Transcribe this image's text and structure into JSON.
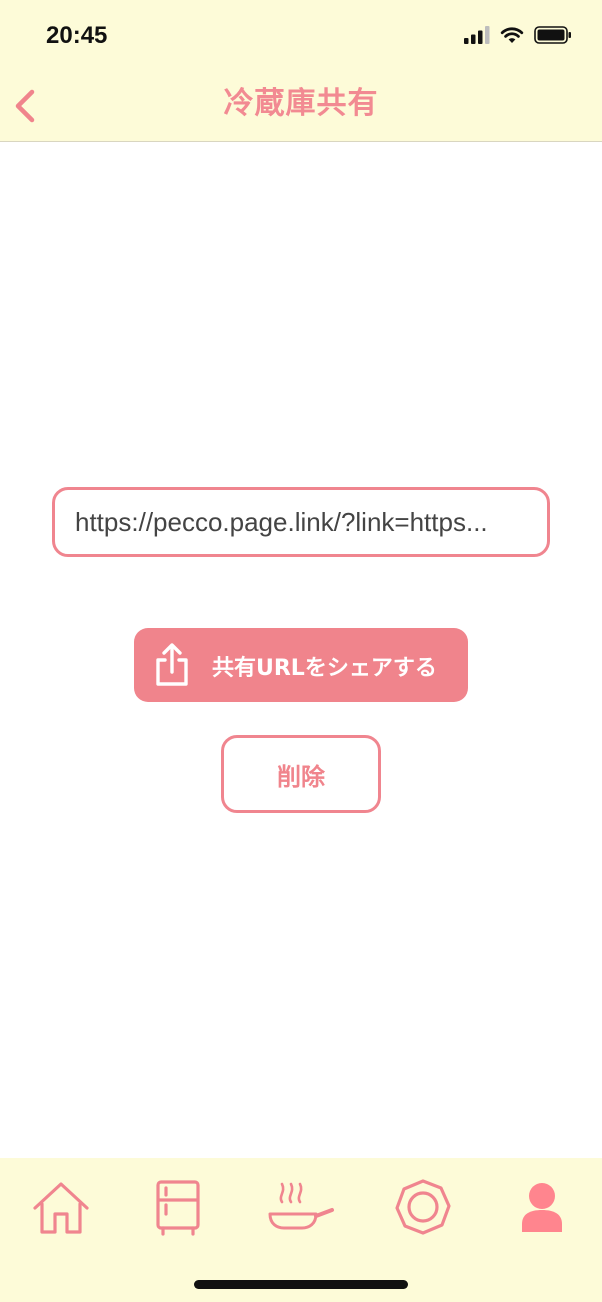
{
  "status_bar": {
    "time": "20:45"
  },
  "nav": {
    "title": "冷蔵庫共有"
  },
  "share_url": {
    "value": "https://pecco.page.link/?link=https..."
  },
  "actions": {
    "share_label": "共有URLをシェアする",
    "delete_label": "削除"
  },
  "tab_bar": {
    "items": [
      {
        "icon": "home-icon"
      },
      {
        "icon": "fridge-icon"
      },
      {
        "icon": "cooking-pan-icon"
      },
      {
        "icon": "octagon-icon"
      },
      {
        "icon": "user-icon",
        "active": true
      }
    ]
  },
  "colors": {
    "accent": "#f0848c",
    "bar_background": "#fdfbd8",
    "background": "#ffffff"
  }
}
